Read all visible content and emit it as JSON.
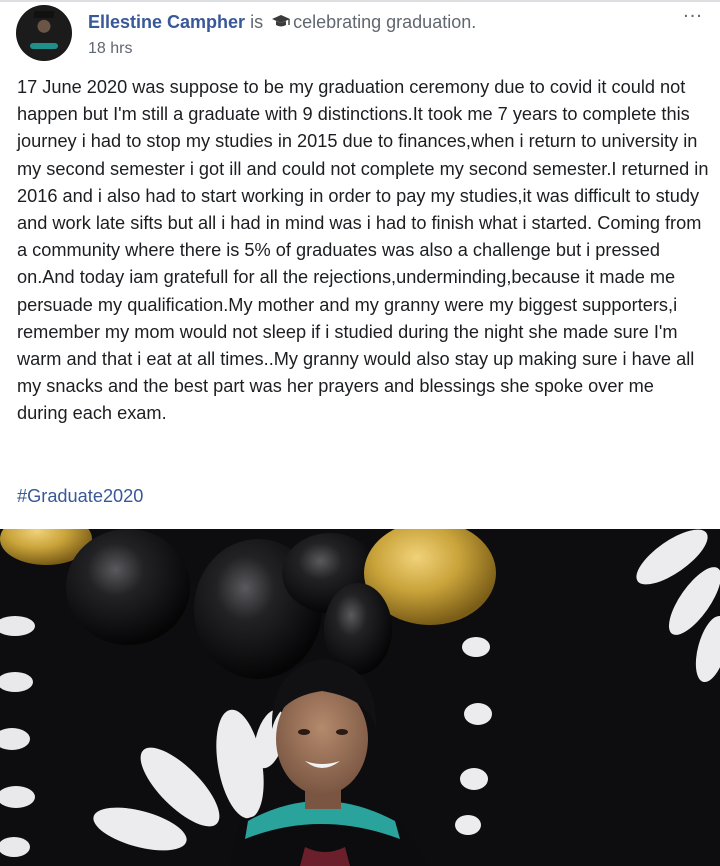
{
  "post": {
    "author": "Ellestine Campher",
    "verb_is": "is",
    "activity_icon": "graduation-cap-icon",
    "activity": "celebrating graduation.",
    "time": "18 hrs",
    "more_label": "...",
    "body": "17 June 2020 was suppose to be my graduation ceremony due to covid it could not happen but I'm still a graduate with 9 distinctions.It took me 7 years to complete this journey i had to stop my studies in 2015 due to finances,when i return to university in my second semester i got ill and could not complete my second semester.I returned in 2016 and i also had to start working in order to pay my studies,it was difficult to study and work late sifts but all i had in mind was i had to finish what i started. Coming from a community where there is 5% of graduates was also a challenge but i pressed on.And today iam gratefull for all the rejections,underminding,because it made me persuade my qualification.My mother and my granny were my biggest supporters,i remember my mom would not sleep if i studied during the night she made sure I'm warm and that i eat at all times..My granny would also stay up making sure i have all my snacks and the best part was her prayers and blessings she spoke over me during each exam.",
    "hashtag": "#Graduate2020"
  },
  "colors": {
    "link_blue": "#385898",
    "secondary_text": "#616770",
    "body_text": "#1c1e21",
    "hood_teal": "#1f8f8a",
    "balloon_gold": "#c9a33a"
  }
}
